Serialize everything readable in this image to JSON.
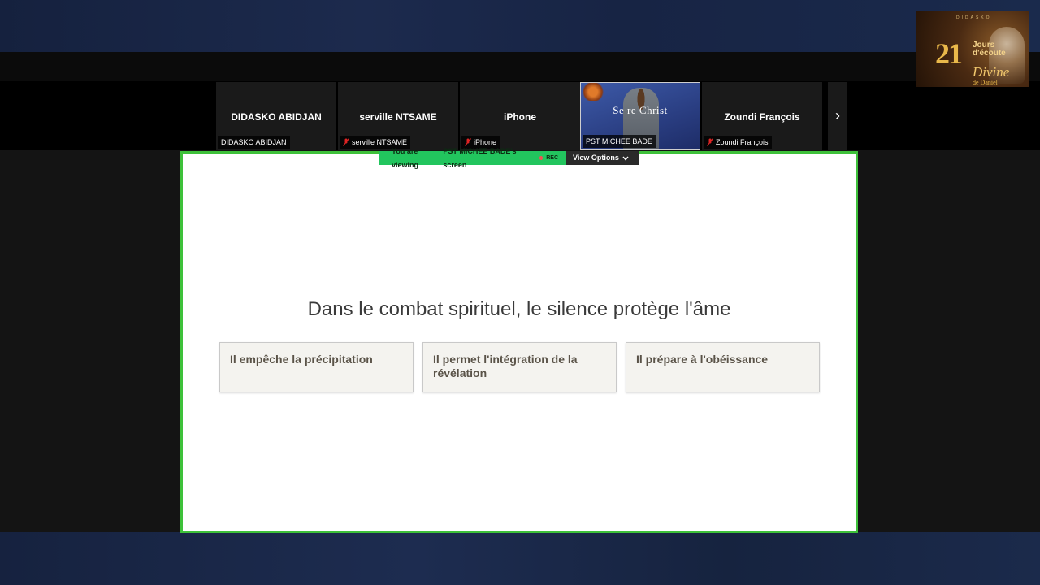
{
  "logo": {
    "top_text": "DIDASKO",
    "number": "21",
    "line1": "Jours d'écoute",
    "line2": "Divine",
    "line3": "de Daniel"
  },
  "participants": [
    {
      "name": "DIDASKO ABIDJAN",
      "tag": "DIDASKO ABIDJAN",
      "muted": false
    },
    {
      "name": "serville NTSAME",
      "tag": "serville NTSAME",
      "muted": true
    },
    {
      "name": "iPhone",
      "tag": "iPhone",
      "muted": true
    },
    {
      "name": "PST MICHEE BADE",
      "tag": "PST MICHEE BADE",
      "muted": false,
      "video_text": "Se  re   Christ"
    },
    {
      "name": "Zoundi François",
      "tag": "Zoundi François",
      "muted": true
    }
  ],
  "share_bar": {
    "prefix": "You are viewing",
    "who": "PST MICHEE BADE's screen",
    "rec": "REC",
    "view_options": "View Options"
  },
  "slide": {
    "title": "Dans le combat spirituel, le silence protège l'âme",
    "cards": [
      "Il empêche la précipitation",
      "Il permet l'intégration de la révélation",
      "Il prépare à l'obéissance"
    ]
  },
  "colors": {
    "share_border": "#3ec13a",
    "viewing_green": "#22c55e",
    "mute_red": "#e02424"
  }
}
